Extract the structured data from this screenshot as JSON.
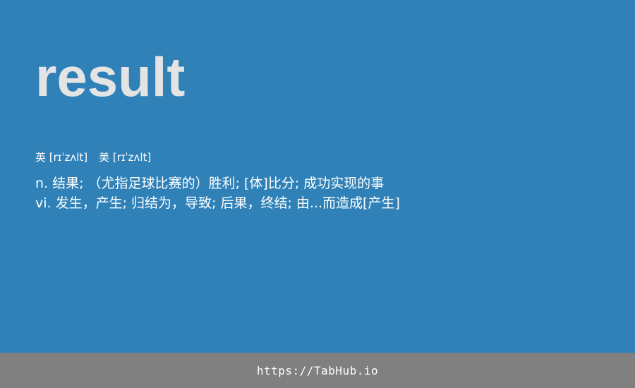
{
  "entry": {
    "word": "result",
    "phonetics": {
      "uk": "英 [rɪˈzʌlt]",
      "us": "美 [rɪˈzʌlt]"
    },
    "definitions": [
      "n. 结果; （尤指足球比赛的）胜利; [体]比分; 成功实现的事",
      "vi. 发生，产生; 归结为，导致; 后果，终结; 由...而造成[产生]"
    ]
  },
  "footer": {
    "link_text": "https://TabHub.io"
  },
  "colors": {
    "background": "#2f81b8",
    "word": "#e4e4e4",
    "text": "#ffffff",
    "footer_bar": "#808080"
  }
}
